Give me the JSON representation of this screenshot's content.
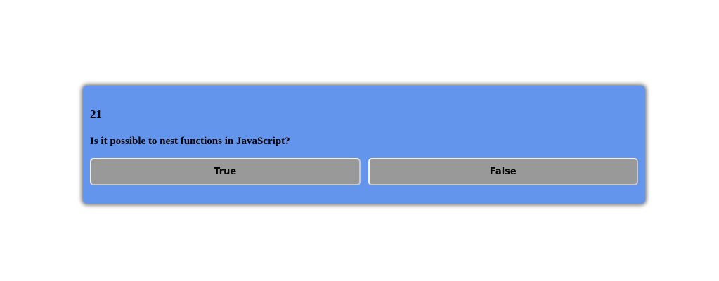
{
  "quiz": {
    "number": "21",
    "question": "Is it possible to nest functions in JavaScript?",
    "answers": [
      {
        "label": "True"
      },
      {
        "label": "False"
      }
    ]
  },
  "colors": {
    "card_background": "#6495ed",
    "button_background": "#999999",
    "page_background": "#ffffff"
  }
}
